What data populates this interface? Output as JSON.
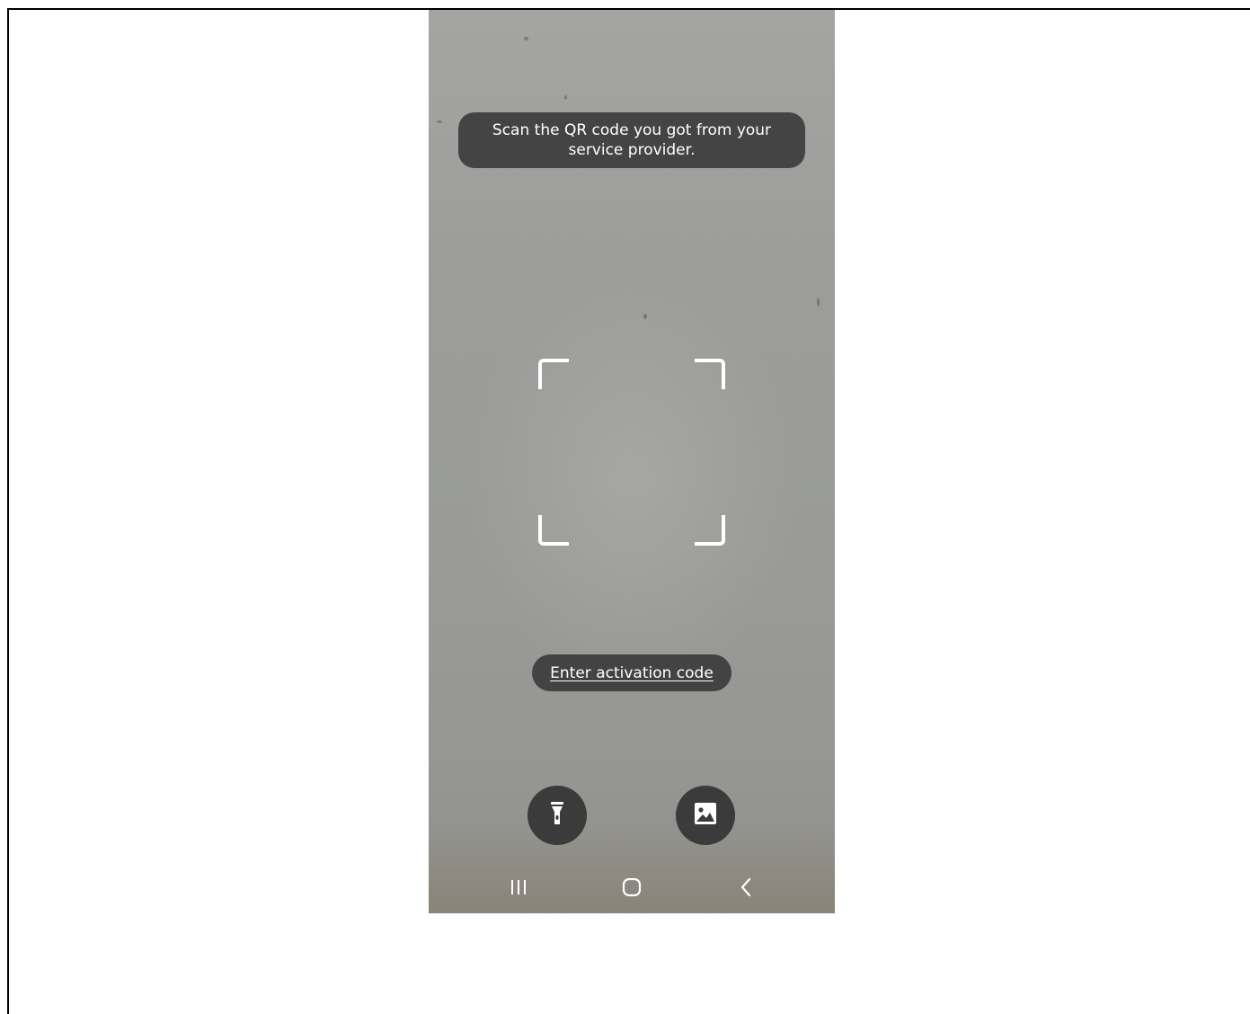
{
  "scanner": {
    "instruction": "Scan the QR code you got from your service provider.",
    "activation_link": "Enter activation code"
  },
  "controls": {
    "flashlight_icon": "flashlight-icon",
    "gallery_icon": "image-gallery-icon"
  },
  "navbar": {
    "recents_icon": "recents-icon",
    "home_icon": "home-icon",
    "back_icon": "back-icon"
  },
  "colors": {
    "overlay": "#3c3c3c",
    "text": "#ffffff",
    "camera_background": "#9c9d9b"
  }
}
